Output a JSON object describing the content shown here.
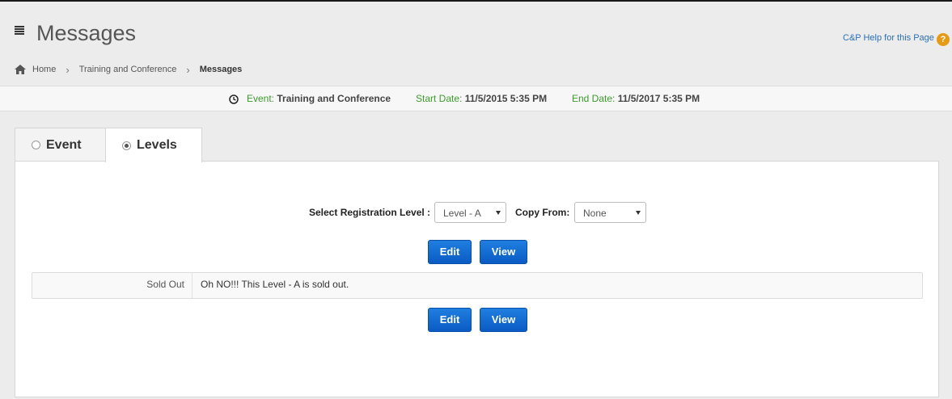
{
  "header": {
    "title": "Messages",
    "help_link": "C&P Help for this Page",
    "help_icon": "?"
  },
  "breadcrumb": {
    "items": [
      "Home",
      "Training and Conference",
      "Messages"
    ],
    "separator": "›"
  },
  "event_bar": {
    "event_label": "Event:",
    "event_value": "Training and Conference",
    "start_label": "Start Date:",
    "start_value": "11/5/2015 5:35 PM",
    "end_label": "End Date:",
    "end_value": "11/5/2017 5:35 PM"
  },
  "tabs": [
    {
      "label": "Event",
      "selected": false
    },
    {
      "label": "Levels",
      "selected": true
    }
  ],
  "form": {
    "level_label": "Select Registration Level :",
    "level_value": "Level - A",
    "copy_label": "Copy From:",
    "copy_value": "None"
  },
  "buttons": {
    "edit": "Edit",
    "view": "View"
  },
  "messages": [
    {
      "label": "Sold Out",
      "text": "Oh NO!!! This Level - A is sold out."
    }
  ],
  "colors": {
    "accent_blue": "#0a5bc4",
    "event_green": "#3c9a2d",
    "help_orange": "#e69b16"
  }
}
